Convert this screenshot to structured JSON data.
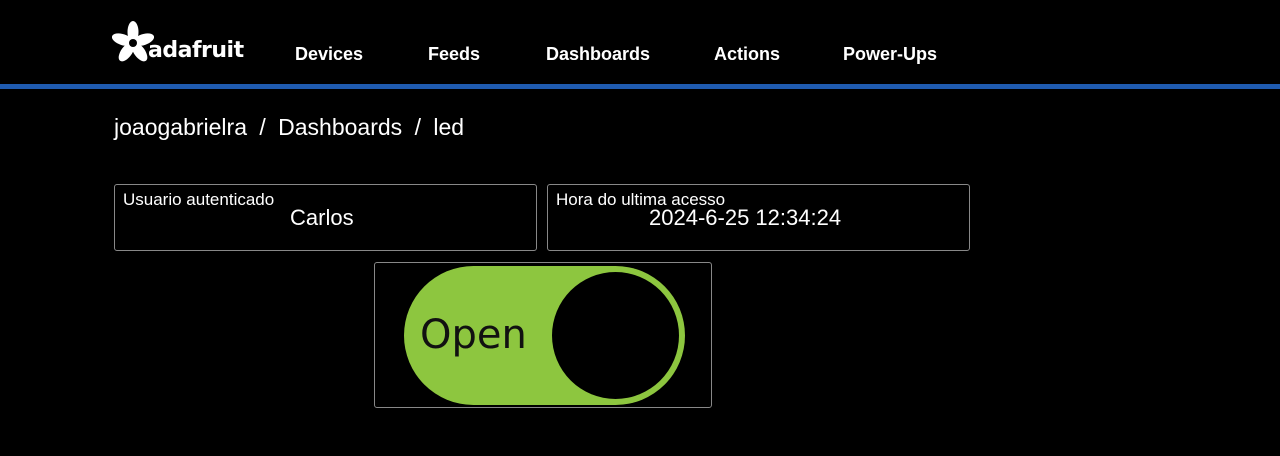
{
  "header": {
    "logo_text": "adafruit",
    "nav": [
      {
        "label": "Devices"
      },
      {
        "label": "Feeds"
      },
      {
        "label": "Dashboards"
      },
      {
        "label": "Actions"
      },
      {
        "label": "Power-Ups"
      }
    ],
    "accent_color": "#1f5bb0"
  },
  "breadcrumb": {
    "user": "joaogabrielra",
    "sep": "/",
    "section": "Dashboards",
    "page": "led"
  },
  "blocks": {
    "user": {
      "label": "Usuario autenticado",
      "value": "Carlos"
    },
    "last_access": {
      "label": "Hora do ultima acesso",
      "value": "2024-6-25 12:34:24"
    }
  },
  "toggle": {
    "label": "Open",
    "state": "on",
    "on_color": "#8dc63f"
  }
}
